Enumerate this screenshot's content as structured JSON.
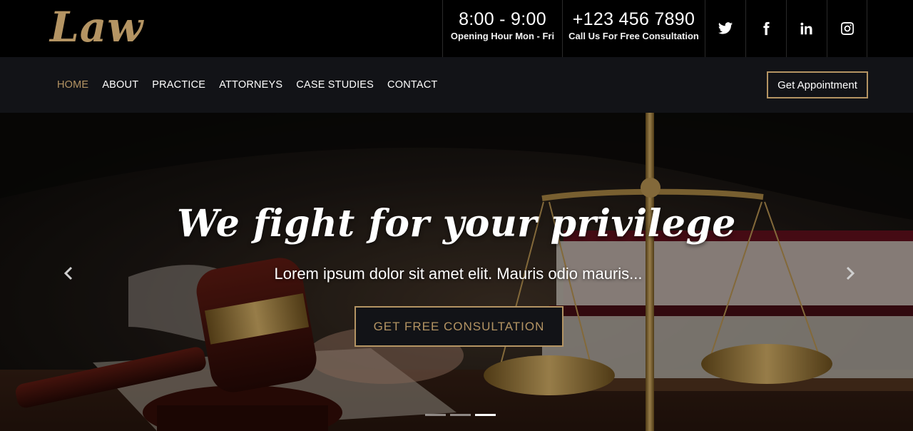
{
  "brand": {
    "logo": "Law",
    "accent": "#b49463"
  },
  "topbar": {
    "hours": {
      "time": "8:00 - 9:00",
      "label": "Opening Hour Mon - Fri"
    },
    "phone": {
      "number": "+123 456 7890",
      "label": "Call Us For Free Consultation"
    },
    "social": [
      "twitter-icon",
      "facebook-icon",
      "linkedin-icon",
      "instagram-icon"
    ]
  },
  "nav": {
    "items": [
      "HOME",
      "ABOUT",
      "PRACTICE",
      "ATTORNEYS",
      "CASE STUDIES",
      "CONTACT"
    ],
    "active": "HOME",
    "appointment": "Get Appointment"
  },
  "hero": {
    "headline": "We fight for your privilege",
    "subline": "Lorem ipsum dolor sit amet elit. Mauris odio mauris...",
    "cta": "GET FREE CONSULTATION",
    "slides": 3,
    "active_slide": 3
  }
}
